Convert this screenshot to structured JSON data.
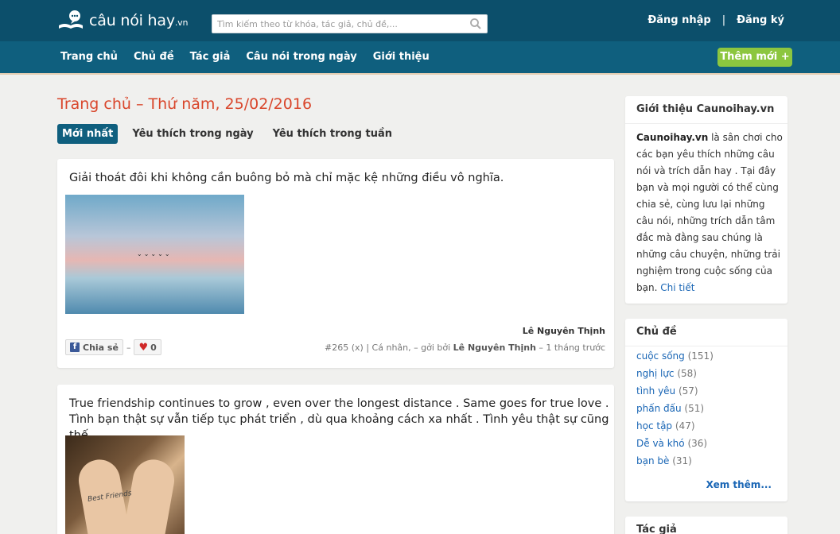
{
  "header": {
    "logo_text": "câu nói hay",
    "logo_tld": ".vn",
    "search_placeholder": "Tìm kiếm theo từ khóa, tác giả, chủ đề,...",
    "login": "Đăng nhập",
    "separator": "|",
    "register": "Đăng ký"
  },
  "nav": {
    "items": [
      "Trang chủ",
      "Chủ đề",
      "Tác giả",
      "Câu nói trong ngày",
      "Giới thiệu"
    ],
    "add_new": "Thêm mới +"
  },
  "main": {
    "title": "Trang chủ – Thứ năm, 25/02/2016",
    "tabs": [
      "Mới nhất",
      "Yêu thích trong ngày",
      "Yêu thích trong tuần"
    ],
    "posts": [
      {
        "quote": "Giải thoát đôi khi không cần buông bỏ mà chỉ mặc kệ những điều vô nghĩa.",
        "author": "Lê Nguyên Thịnh",
        "share": "Chia sẻ",
        "dash": "–",
        "likes": "0",
        "meta_prefix": "#265  (x) | Cá nhân, – gởi bởi ",
        "meta_user": "Lê Nguyên Thịnh",
        "meta_suffix": " – 1 tháng trước"
      },
      {
        "quote": "True friendship continues to grow , even over the longest distance . Same goes for true love . Tình bạn thật sự vẫn tiếp tục phát triển , dù qua khoảng cách xa nhất . Tình yêu thật sự cũng thế .",
        "image_text": "Best Friends"
      }
    ]
  },
  "sidebar": {
    "intro_title": "Giới thiệu Caunoihay.vn",
    "intro_brand": "Caunoihay.vn",
    "intro_body": " là sân chơi cho các bạn yêu thích những câu nói và trích dẫn hay . Tại đây bạn và mọi người có thể cùng chia sẻ, cùng lưu lại những câu nói, những trích dẫn tâm đắc mà đằng sau chúng là những câu chuyện, những trải nghiệm trong cuộc sống của bạn. ",
    "intro_more": "Chi tiết",
    "topics_title": "Chủ đề",
    "topics": [
      {
        "name": "cuộc sống",
        "count": "(151)"
      },
      {
        "name": "nghị lực",
        "count": "(58)"
      },
      {
        "name": "tình yêu",
        "count": "(57)"
      },
      {
        "name": "phấn đấu",
        "count": "(51)"
      },
      {
        "name": "học tập",
        "count": "(47)"
      },
      {
        "name": "Dễ và khó",
        "count": "(36)"
      },
      {
        "name": "bạn bè",
        "count": "(31)"
      }
    ],
    "see_more": "Xem thêm...",
    "authors_title": "Tác giả"
  },
  "colors": {
    "header_bg": "#0c4f6b",
    "nav_bg": "#0f5f7e",
    "accent_red": "#d9462b",
    "add_button": "#8cc63f",
    "link_blue": "#1a66b5"
  }
}
